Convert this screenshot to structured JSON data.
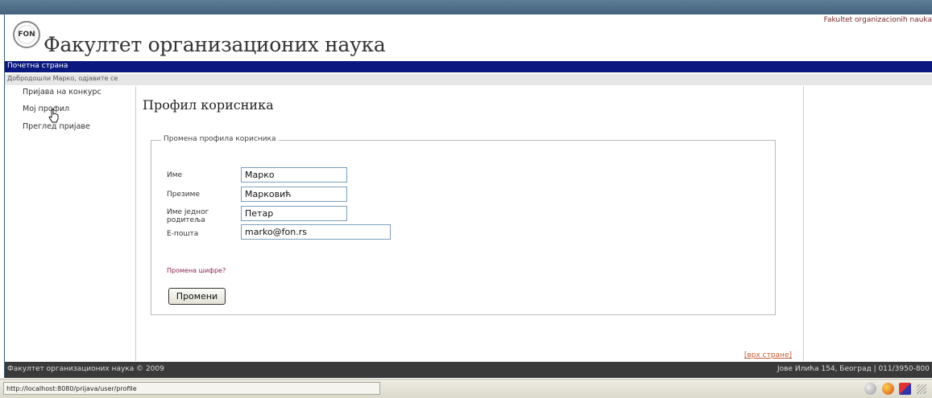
{
  "header": {
    "site_title": "Факултет организационих наука",
    "site_name_latin": "Fakultet organizacionih nauka",
    "logo_text": "FON"
  },
  "nav": {
    "home_label": "Почетна страна"
  },
  "welcome_bar": {
    "text": "Добродошли Марко, одјавите се"
  },
  "sidebar": {
    "items": [
      {
        "label": "Пријава на конкурс"
      },
      {
        "label": "Мој профил"
      },
      {
        "label": "Преглед пријаве"
      }
    ]
  },
  "main": {
    "page_title": "Профил корисника",
    "form": {
      "legend": "Промена профила корисника",
      "fields": [
        {
          "label": "Име",
          "value": "Марко"
        },
        {
          "label": "Презиме",
          "value": "Марковић"
        },
        {
          "label": "Име једног родитеља",
          "value": "Петар"
        },
        {
          "label": "Е-пошта",
          "value": "marko@fon.rs"
        }
      ],
      "change_password_link": "Промена шифре?",
      "submit_label": "Промени"
    },
    "back_to_top": "[врх стране]"
  },
  "footer": {
    "left": "Факултет организационих наука © 2009",
    "right": "Јове Илића 154, Београд | 011/3950-800"
  },
  "browser_status": {
    "url": "http://localhost:8080/prijava/user/profile"
  },
  "colors": {
    "navbar": "#0b1880",
    "footer": "#3a3a3a",
    "link_maroon": "#8b2252",
    "link_orange": "#c25a30"
  }
}
